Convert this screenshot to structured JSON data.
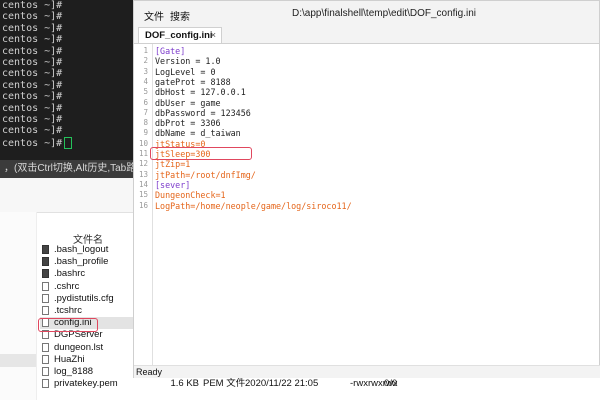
{
  "terminal": {
    "prompt_lines": [
      "centos ~]#",
      "centos ~]#",
      "centos ~]#",
      "centos ~]#",
      "centos ~]#",
      "centos ~]#",
      "centos ~]#",
      "centos ~]#",
      "centos ~]#",
      "centos ~]#",
      "centos ~]#",
      "centos ~]#",
      "centos ~]#"
    ],
    "hint": "，(双击Ctrl切换,Alt历史,Tab路径/命令"
  },
  "file_manager": {
    "column_filename": "文件名",
    "files": [
      {
        "name": ".bash_logout",
        "icon": "doc-dark-icon",
        "size": "",
        "type": "",
        "date": "",
        "perm": "",
        "owner": ""
      },
      {
        "name": ".bash_profile",
        "icon": "doc-dark-icon",
        "size": "",
        "type": "",
        "date": "",
        "perm": "",
        "owner": ""
      },
      {
        "name": ".bashrc",
        "icon": "doc-dark-icon",
        "size": "",
        "type": "",
        "date": "",
        "perm": "",
        "owner": ""
      },
      {
        "name": ".cshrc",
        "icon": "doc-icon",
        "size": "",
        "type": "",
        "date": "",
        "perm": "",
        "owner": ""
      },
      {
        "name": ".pydistutils.cfg",
        "icon": "gear-doc-icon",
        "size": "",
        "type": "",
        "date": "",
        "perm": "",
        "owner": ""
      },
      {
        "name": ".tcshrc",
        "icon": "doc-icon",
        "size": "",
        "type": "",
        "date": "",
        "perm": "",
        "owner": ""
      },
      {
        "name": "config.ini",
        "icon": "doc-icon",
        "size": "",
        "type": "",
        "date": "",
        "perm": "",
        "owner": ""
      },
      {
        "name": "DGPServer",
        "icon": "doc-icon",
        "size": "",
        "type": "",
        "date": "",
        "perm": "",
        "owner": ""
      },
      {
        "name": "dungeon.lst",
        "icon": "doc-icon",
        "size": "",
        "type": "",
        "date": "",
        "perm": "",
        "owner": ""
      },
      {
        "name": "HuaZhi",
        "icon": "doc-icon",
        "size": "",
        "type": "",
        "date": "",
        "perm": "",
        "owner": ""
      },
      {
        "name": "log_8188",
        "icon": "doc-icon",
        "size": "",
        "type": "",
        "date": "",
        "perm": "",
        "owner": ""
      },
      {
        "name": "privatekey.pem",
        "icon": "doc-icon",
        "size": "1.6 KB",
        "type": "PEM 文件",
        "date": "2020/11/22 21:05",
        "perm": "-rwxrwxrwx",
        "owner": "0/0"
      }
    ]
  },
  "editor": {
    "menu_file": "文件",
    "menu_search": "搜索",
    "path": "D:\\app\\finalshell\\temp\\edit\\DOF_config.ini",
    "tab_title": "DOF_config.ini",
    "tab_close": "×",
    "lines": [
      {
        "n": "1",
        "text": "[Gate]",
        "cls": "c-section"
      },
      {
        "n": "2",
        "text": "Version = 1.0",
        "cls": "c-key"
      },
      {
        "n": "3",
        "text": "LogLevel = 0",
        "cls": "c-key"
      },
      {
        "n": "4",
        "text": "gateProt = 8188",
        "cls": "c-key"
      },
      {
        "n": "5",
        "text": "dbHost = 127.0.0.1",
        "cls": "c-key"
      },
      {
        "n": "6",
        "text": "dbUser = game",
        "cls": "c-key"
      },
      {
        "n": "7",
        "text": "dbPassword = 123456",
        "cls": "c-key"
      },
      {
        "n": "8",
        "text": "dbProt = 3306",
        "cls": "c-key"
      },
      {
        "n": "9",
        "text": "dbName = d_taiwan",
        "cls": "c-key"
      },
      {
        "n": "10",
        "text": "jtStatus=0",
        "cls": "c-kw"
      },
      {
        "n": "11",
        "text": "jtSleep=300",
        "cls": "c-kw"
      },
      {
        "n": "12",
        "text": "jtZip=1",
        "cls": "c-kw"
      },
      {
        "n": "13",
        "text": "jtPath=/root/dnfImg/",
        "cls": "c-kw"
      },
      {
        "n": "14",
        "text": "[sever]",
        "cls": "c-section"
      },
      {
        "n": "15",
        "text": "DungeonCheck=1",
        "cls": "c-kw"
      },
      {
        "n": "16",
        "text": "LogPath=/home/neople/game/log/siroco11/",
        "cls": "c-kw"
      }
    ],
    "status": "Ready"
  }
}
